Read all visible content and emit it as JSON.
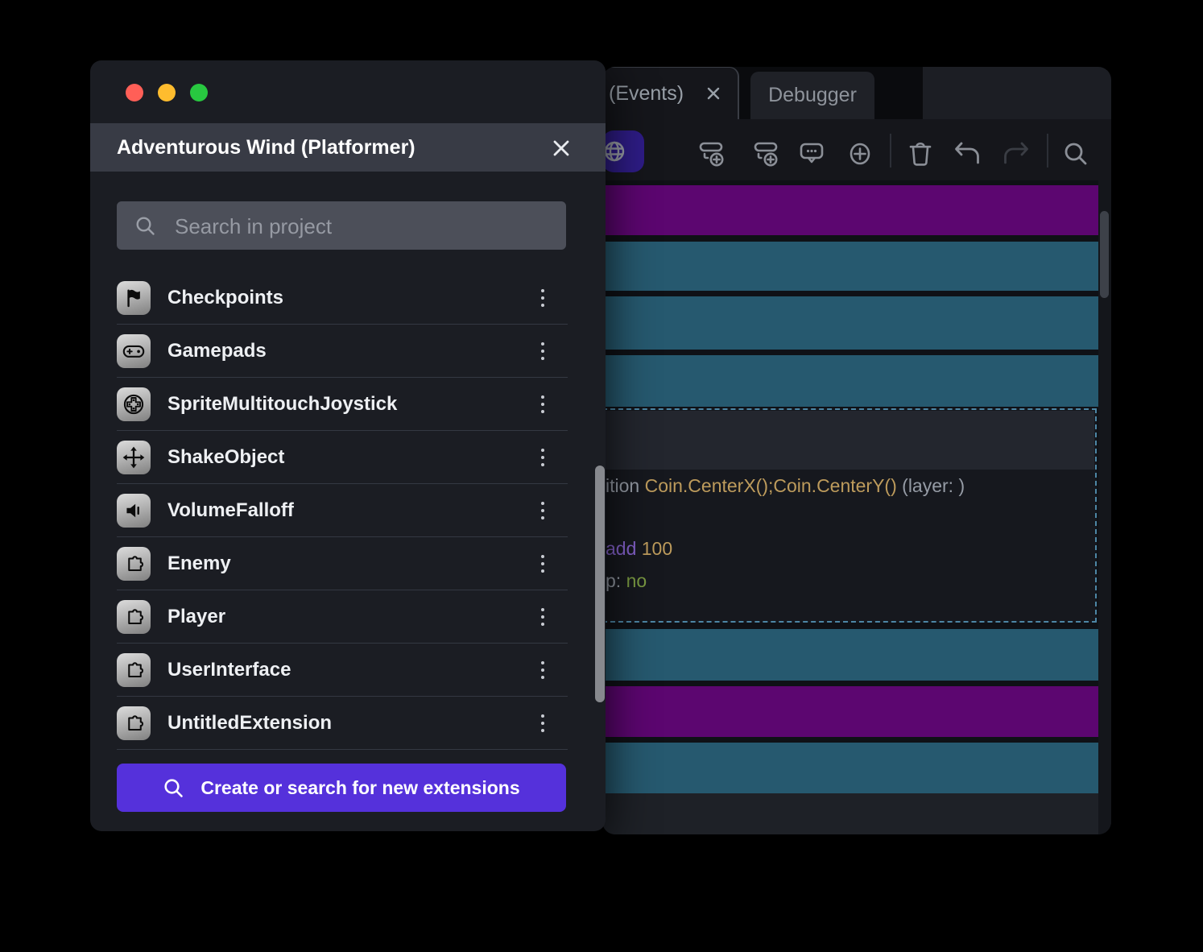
{
  "dialog": {
    "title": "Adventurous Wind (Platformer)",
    "search": {
      "placeholder": "Search in project"
    },
    "items": [
      {
        "label": "Checkpoints",
        "icon": "flag-icon"
      },
      {
        "label": "Gamepads",
        "icon": "gamepad-icon"
      },
      {
        "label": "SpriteMultitouchJoystick",
        "icon": "joystick-icon"
      },
      {
        "label": "ShakeObject",
        "icon": "move-arrows-icon"
      },
      {
        "label": "VolumeFalloff",
        "icon": "speaker-icon"
      },
      {
        "label": "Enemy",
        "icon": "puzzle-icon"
      },
      {
        "label": "Player",
        "icon": "puzzle-icon"
      },
      {
        "label": "UserInterface",
        "icon": "puzzle-icon"
      },
      {
        "label": "UntitledExtension",
        "icon": "puzzle-icon"
      }
    ],
    "create_button": {
      "label": "Create or search for new extensions"
    }
  },
  "events": {
    "tabs": [
      {
        "label": "(Events)",
        "active": true,
        "closable": true
      },
      {
        "label": "Debugger",
        "active": false
      }
    ],
    "toolbar_icons": [
      "globe",
      "add-event",
      "add-subevent",
      "add-comment",
      "add-circle",
      "trash",
      "undo",
      "redo",
      "search"
    ],
    "rows": [
      {
        "kind": "purple"
      },
      {
        "kind": "teal"
      },
      {
        "kind": "teal"
      },
      {
        "kind": "teal"
      },
      {
        "kind": "selected"
      },
      {
        "kind": "teal"
      },
      {
        "kind": "purple"
      },
      {
        "kind": "teal"
      }
    ],
    "selected": {
      "lines": [
        {
          "segments": [
            {
              "text": "ition ",
              "color": "gray"
            },
            {
              "text": "Coin.CenterX();Coin.CenterY()",
              "color": "gold"
            },
            {
              "text": " (layer: )",
              "color": "gray"
            }
          ]
        },
        {
          "segments": [
            {
              "text": "add ",
              "color": "purple"
            },
            {
              "text": "100",
              "color": "gold"
            }
          ]
        },
        {
          "segments": [
            {
              "text": "p: ",
              "color": "gray"
            },
            {
              "text": "no",
              "color": "green"
            }
          ]
        }
      ]
    }
  },
  "colors": {
    "event_purple": "#5c0670",
    "event_teal": "#26596f",
    "selection_dash": "#4d86a5",
    "create_button_purple": "#5531db",
    "toolbar_active_indigo": "#2e1c86",
    "code_gray": "#959ba5",
    "code_gold": "#bd9b5c",
    "code_purple": "#8562cc",
    "code_green": "#7a9a42",
    "traffic_red": "#ff5f57",
    "traffic_yellow": "#febc2e",
    "traffic_green": "#28c840"
  }
}
